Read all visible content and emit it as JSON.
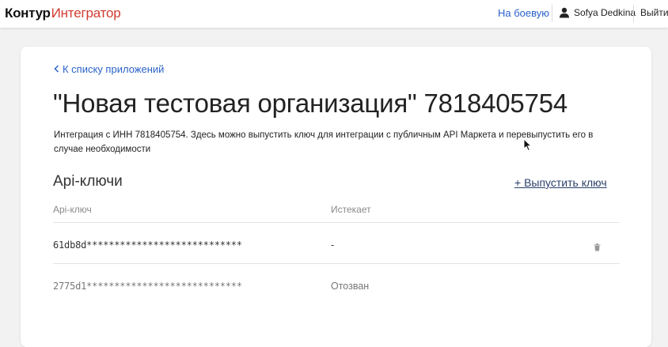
{
  "header": {
    "logo_brand": "Контур",
    "logo_product": "Интегратор",
    "nav_production": "На боевую",
    "user_name": "Sofya Dedkina",
    "logout": "Выйти"
  },
  "page": {
    "back_link": "К списку приложений",
    "title": "\"Новая тестовая организация\" 7818405754",
    "description": "Интеграция с ИНН 7818405754. Здесь можно выпустить ключ для интеграции с публичным API Маркета и перевыпустить его в случае необходимости"
  },
  "api_keys": {
    "section_title": "Api-ключи",
    "issue_button": "+ Выпустить ключ",
    "columns": {
      "key": "Api-ключ",
      "expires": "Истекает"
    },
    "rows": [
      {
        "key": "61db8d****************************",
        "expires": "-",
        "state": "active",
        "text_color": "#333333"
      },
      {
        "key": "2775d1****************************",
        "expires": "Отозван",
        "state": "revoked",
        "text_color": "#777777"
      }
    ]
  },
  "icons": {
    "back": "chevron-left-icon",
    "user": "user-icon",
    "delete": "trash-icon",
    "cursor": "mouse-cursor-icon"
  },
  "colors": {
    "accent_link": "#2a62c9",
    "brand_red": "#d13b2f",
    "button_text": "#2a3f6b",
    "page_bg": "#f2f2f2"
  }
}
